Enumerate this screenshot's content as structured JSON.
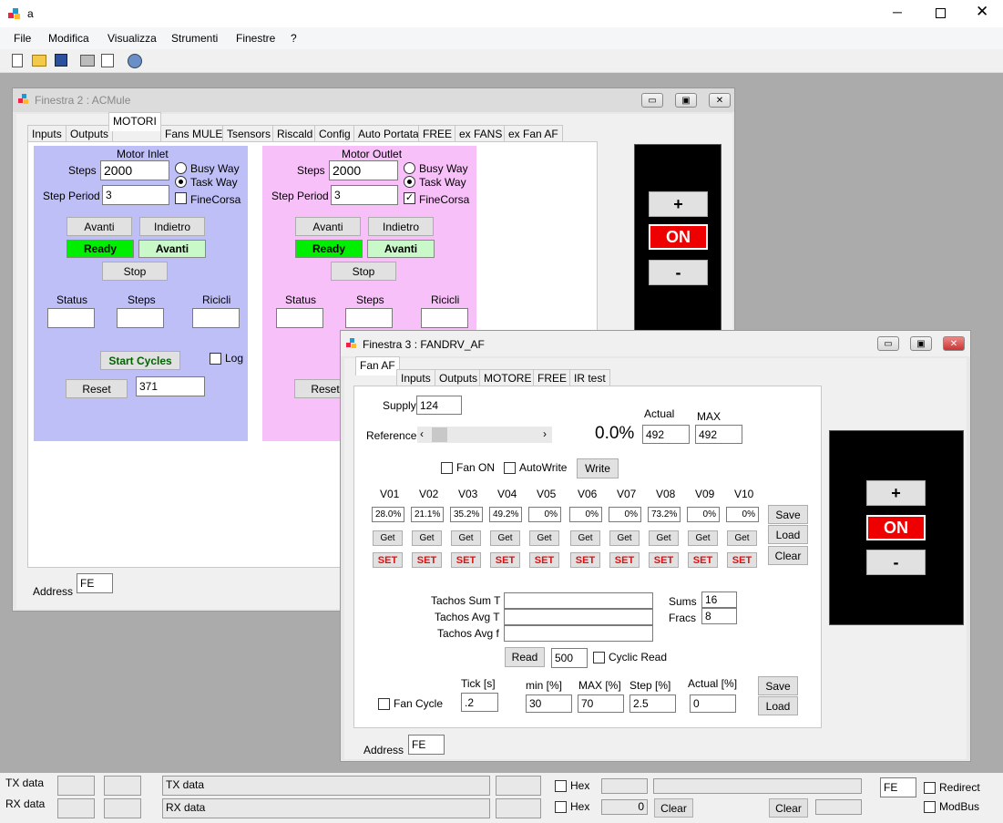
{
  "app": {
    "title": "a",
    "menu": [
      "File",
      "Modifica",
      "Visualizza",
      "Strumenti",
      "Finestre",
      "?"
    ]
  },
  "win2": {
    "title": "Finestra 2 : ACMule",
    "tabs": [
      "Inputs",
      "Outputs",
      "MOTORI",
      "Fans MULE",
      "Tsensors",
      "Riscald",
      "Config",
      "Auto Portata",
      "FREE",
      "ex FANS",
      "ex Fan AF"
    ],
    "inlet": {
      "title": "Motor Inlet",
      "steps_label": "Steps",
      "steps": "2000",
      "period_label": "Step Period",
      "period": "3",
      "busy": "Busy Way",
      "task": "Task Way",
      "fine": "FineCorsa",
      "avanti": "Avanti",
      "indietro": "Indietro",
      "ready": "Ready",
      "avanti_status": "Avanti",
      "stop": "Stop",
      "status": "Status",
      "steps2": "Steps",
      "ricicli": "Ricicli",
      "start": "Start Cycles",
      "log": "Log",
      "reset": "Reset",
      "reset_val": "371"
    },
    "outlet": {
      "title": "Motor Outlet",
      "steps_label": "Steps",
      "steps": "2000",
      "period_label": "Step Period",
      "period": "3",
      "busy": "Busy Way",
      "task": "Task Way",
      "fine": "FineCorsa",
      "avanti": "Avanti",
      "indietro": "Indietro",
      "ready": "Ready",
      "avanti_status": "Avanti",
      "stop": "Stop",
      "status": "Status",
      "steps2": "Steps",
      "ricicli": "Ricicli",
      "reset": "Reset"
    },
    "address_label": "Address",
    "address": "FE",
    "panel": {
      "plus": "+",
      "on": "ON",
      "minus": "-"
    }
  },
  "win3": {
    "title": "Finestra 3 : FANDRV_AF",
    "tabs": [
      "Fan AF",
      "Inputs",
      "Outputs",
      "MOTORE",
      "FREE",
      "IR test"
    ],
    "supply_label": "Supply",
    "supply": "124",
    "actual_label": "Actual",
    "max_label": "MAX",
    "actual": "492",
    "max": "492",
    "reference_label": "Reference",
    "percent": "0.0%",
    "fan_on": "Fan ON",
    "autowrite": "AutoWrite",
    "write": "Write",
    "vlabels": [
      "V01",
      "V02",
      "V03",
      "V04",
      "V05",
      "V06",
      "V07",
      "V08",
      "V09",
      "V10"
    ],
    "vvalues": [
      "28.0%",
      "21.1%",
      "35.2%",
      "49.2%",
      "0%",
      "0%",
      "0%",
      "73.2%",
      "0%",
      "0%"
    ],
    "get": "Get",
    "set": "SET",
    "save": "Save",
    "load": "Load",
    "clear": "Clear",
    "sum_t": "Tachos Sum T",
    "avg_t": "Tachos Avg T",
    "avg_f": "Tachos Avg f",
    "sums_label": "Sums",
    "sums": "16",
    "fracs_label": "Fracs",
    "fracs": "8",
    "read": "Read",
    "read_val": "500",
    "cyclic": "Cyclic Read",
    "fan_cycle": "Fan Cycle",
    "tick_label": "Tick [s]",
    "tick": ".2",
    "min_label": "min [%]",
    "min": "30",
    "maxp_label": "MAX [%]",
    "maxp": "70",
    "step_label": "Step [%]",
    "step": "2.5",
    "actp_label": "Actual  [%]",
    "actp": "0",
    "save2": "Save",
    "load2": "Load",
    "address_label": "Address",
    "address": "FE",
    "panel": {
      "plus": "+",
      "on": "ON",
      "minus": "-"
    }
  },
  "status": {
    "tx": "TX data",
    "rx": "RX data",
    "tx2": "TX data",
    "rx2": "RX data",
    "hex": "Hex",
    "hex2": "Hex",
    "zero": "0",
    "clear": "Clear",
    "clear2": "Clear",
    "fe": "FE",
    "redirect": "Redirect",
    "modbus": "ModBus"
  }
}
